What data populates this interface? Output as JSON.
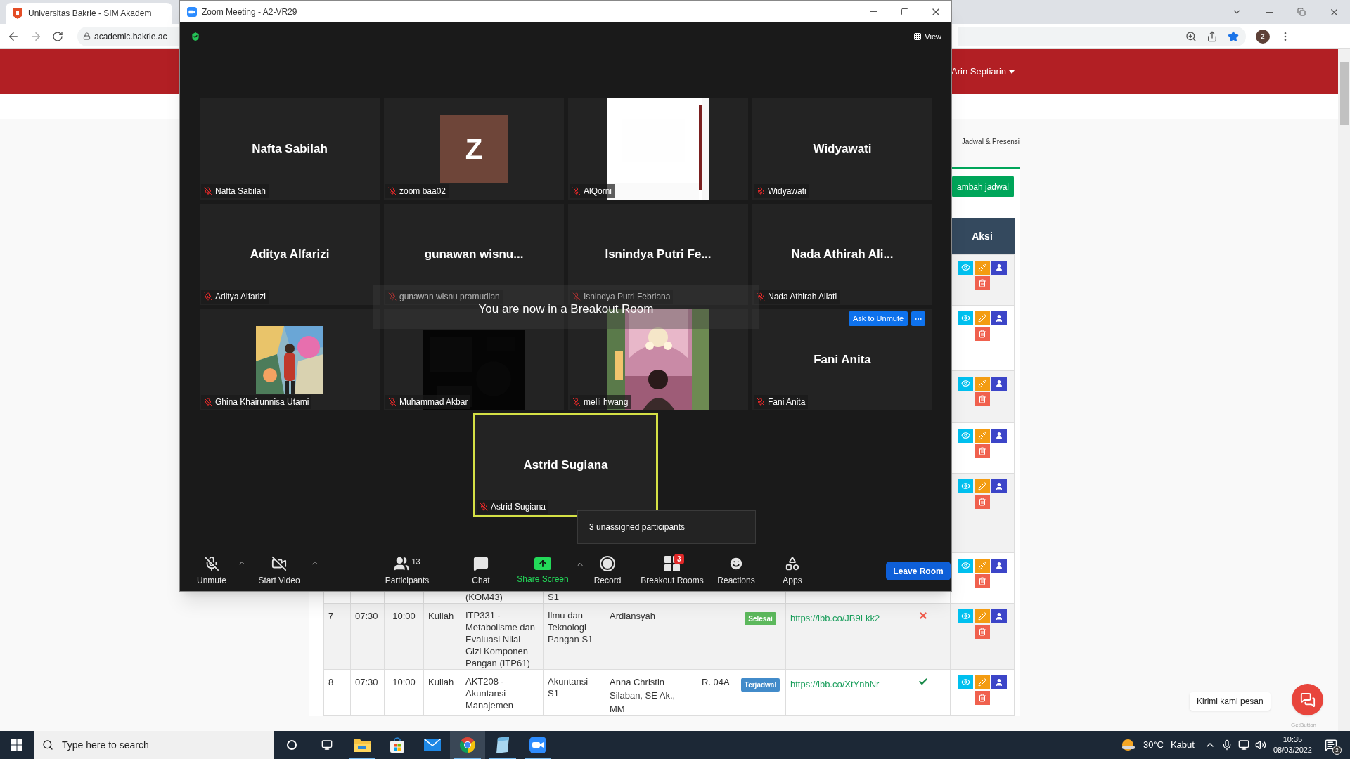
{
  "browser": {
    "tab": {
      "title": "Universitas Bakrie - SIM Akadem"
    },
    "address": "academic.bakrie.ac",
    "profile": "z"
  },
  "site": {
    "user": "Arin Septiarin",
    "breadcrumb": "Jadwal & Presensi",
    "add_button": "ambah jadwal",
    "table": {
      "columns": [
        {
          "label": "Aksi"
        }
      ],
      "rows": [
        {
          "actions": [
            {
              "kind": "view"
            },
            {
              "kind": "edit"
            },
            {
              "kind": "assign"
            },
            {
              "kind": "delete"
            }
          ]
        },
        {
          "actions": [
            {
              "kind": "view"
            },
            {
              "kind": "edit"
            },
            {
              "kind": "assign"
            },
            {
              "kind": "delete"
            }
          ]
        },
        {
          "actions": [
            {
              "kind": "view"
            },
            {
              "kind": "edit"
            },
            {
              "kind": "assign"
            },
            {
              "kind": "delete"
            }
          ]
        },
        {
          "actions": [
            {
              "kind": "view"
            },
            {
              "kind": "edit"
            },
            {
              "kind": "assign"
            },
            {
              "kind": "delete"
            }
          ]
        },
        {
          "actions": [
            {
              "kind": "view"
            },
            {
              "kind": "edit"
            },
            {
              "kind": "assign"
            },
            {
              "kind": "delete"
            }
          ]
        },
        {
          "course": "(KOM43)",
          "program": "S1",
          "actions": [
            {
              "kind": "view"
            },
            {
              "kind": "edit"
            },
            {
              "kind": "assign"
            },
            {
              "kind": "delete"
            }
          ]
        },
        {
          "no": "7",
          "start": "07:30",
          "end": "10:00",
          "type": "Kuliah",
          "course": "ITP331 - Metabolisme dan Evaluasi Nilai Gizi Komponen Pangan (ITP61)",
          "program": "Ilmu dan Teknologi Pangan S1",
          "lecturer": "Ardiansyah",
          "status": {
            "label": "Selesai",
            "color": "#5cb85c"
          },
          "link": "https://ibb.co/JB9Lkk2",
          "attendance": {
            "kind": "cross"
          },
          "actions": [
            {
              "kind": "view"
            },
            {
              "kind": "edit"
            },
            {
              "kind": "assign"
            },
            {
              "kind": "delete"
            }
          ]
        },
        {
          "no": "8",
          "start": "07:30",
          "end": "10:00",
          "type": "Kuliah",
          "course": "AKT208 - Akuntansi Manajemen",
          "program": "Akuntansi S1",
          "lecturer": "Anna Christin Silaban, SE Ak., MM",
          "room": "R. 04A",
          "status": {
            "label": "Terjadwal",
            "color": "#428bca"
          },
          "link": "https://ibb.co/XtYnbNr",
          "attendance": {
            "kind": "check"
          },
          "actions": [
            {
              "kind": "view"
            },
            {
              "kind": "edit"
            },
            {
              "kind": "assign"
            },
            {
              "kind": "delete"
            }
          ]
        }
      ]
    },
    "chat_widget": {
      "message": "Kirimi kami pesan",
      "credit": "GetButton"
    }
  },
  "zoom": {
    "title": "Zoom Meeting - A2-VR29",
    "view_button": "View",
    "tiles": [
      {
        "kind": "name",
        "display": "Nafta Sabilah",
        "label": "Nafta Sabilah",
        "muted": true,
        "speaking": false
      },
      {
        "kind": "avatar",
        "display": "Z",
        "label": "zoom baa02",
        "muted": true,
        "speaking": false
      },
      {
        "kind": "picture",
        "label": "AlQorni",
        "muted": true,
        "speaking": false
      },
      {
        "kind": "name",
        "display": "Widyawati",
        "label": "Widyawati",
        "muted": true,
        "speaking": false
      },
      {
        "kind": "name",
        "display": "Aditya Alfarizi",
        "label": "Aditya Alfarizi",
        "muted": true,
        "speaking": false
      },
      {
        "kind": "name",
        "display": "gunawan  wisnu...",
        "label": "gunawan wisnu pramudian",
        "muted": true,
        "speaking": false
      },
      {
        "kind": "name",
        "display": "Isnindya Putri Fe...",
        "label": "Isnindya Putri Febriana",
        "muted": true,
        "speaking": false
      },
      {
        "kind": "name",
        "display": "Nada Athirah Ali...",
        "label": "Nada Athirah Aliati",
        "muted": true,
        "speaking": false
      },
      {
        "kind": "picture",
        "label": "Ghina Khairunnisa Utami",
        "muted": true,
        "speaking": false
      },
      {
        "kind": "picture",
        "label": "Muhammad Akbar",
        "muted": true,
        "speaking": false
      },
      {
        "kind": "picture",
        "label": "melli hwang",
        "muted": true,
        "speaking": false
      },
      {
        "kind": "name",
        "display": "Fani Anita",
        "label": "Fani Anita",
        "muted": true,
        "speaking": false
      },
      {
        "kind": "name",
        "display": "Astrid Sugiana",
        "label": "Astrid Sugiana",
        "muted": true,
        "speaking": true
      }
    ],
    "banner": "You are now in a Breakout Room",
    "ask_unmute": "Ask to Unmute",
    "tooltip": "3 unassigned participants",
    "toolbar": [
      {
        "kind": "mic",
        "label": "Unmute",
        "menu": true
      },
      {
        "kind": "video",
        "label": "Start Video",
        "menu": true
      },
      {
        "kind": "participants",
        "label": "Participants",
        "count": "13",
        "menu": false
      },
      {
        "kind": "chat",
        "label": "Chat",
        "menu": false
      },
      {
        "kind": "share",
        "label": "Share Screen",
        "menu": true
      },
      {
        "kind": "record",
        "label": "Record",
        "menu": false
      },
      {
        "kind": "breakout",
        "label": "Breakout Rooms",
        "badge": "3",
        "menu": false
      },
      {
        "kind": "reactions",
        "label": "Reactions",
        "menu": false
      },
      {
        "kind": "apps",
        "label": "Apps",
        "menu": false
      }
    ],
    "leave": "Leave Room"
  },
  "taskbar": {
    "search_placeholder": "Type here to search",
    "apps": [
      {
        "kind": "files",
        "selected": false,
        "running": true
      },
      {
        "kind": "store",
        "selected": false,
        "running": false
      },
      {
        "kind": "mail",
        "selected": false,
        "running": false
      },
      {
        "kind": "chrome",
        "selected": true,
        "running": true
      },
      {
        "kind": "notes",
        "selected": false,
        "running": true
      },
      {
        "kind": "zoom",
        "selected": false,
        "running": true
      }
    ],
    "temperature": "30°C",
    "condition": "Kabut",
    "time": "10:35",
    "date": "08/03/2022",
    "notifications": "2"
  }
}
